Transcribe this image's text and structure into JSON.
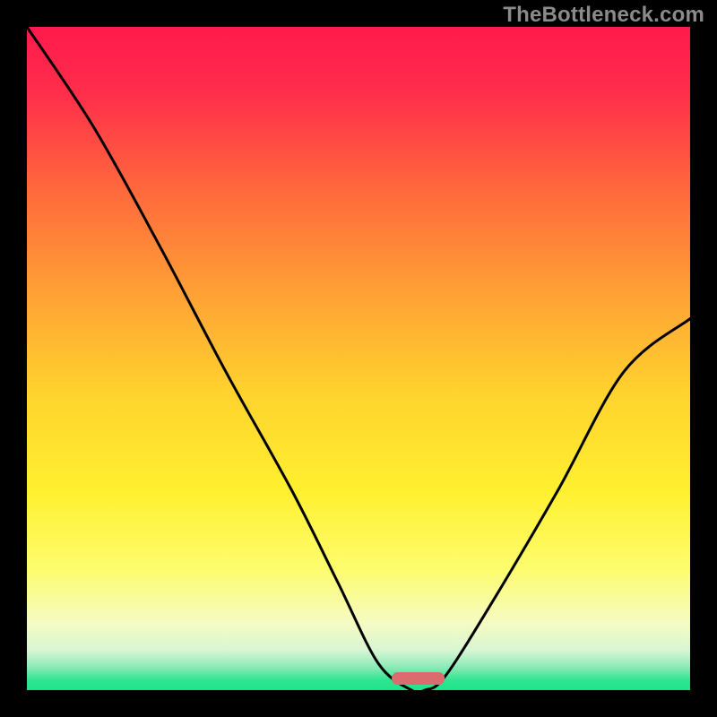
{
  "attribution": "TheBottleneck.com",
  "chart_data": {
    "type": "line",
    "title": "",
    "xlabel": "",
    "ylabel": "",
    "xlim": [
      0,
      100
    ],
    "ylim": [
      0,
      100
    ],
    "grid": false,
    "series": [
      {
        "name": "bottleneck-curve",
        "x": [
          0,
          10,
          20,
          30,
          40,
          47,
          53,
          58,
          60,
          63,
          70,
          80,
          90,
          100
        ],
        "values": [
          100,
          85,
          67,
          48,
          30,
          16,
          4,
          0,
          0,
          2,
          13,
          30,
          48,
          56
        ]
      }
    ],
    "marker": {
      "name": "optimum-pill",
      "x_center": 59,
      "width": 8,
      "color": "#db6b6f"
    },
    "gradient_stops": [
      {
        "offset": 0.0,
        "color": "#ff1a4d"
      },
      {
        "offset": 0.1,
        "color": "#ff2e4a"
      },
      {
        "offset": 0.25,
        "color": "#ff6a3c"
      },
      {
        "offset": 0.4,
        "color": "#ffa035"
      },
      {
        "offset": 0.55,
        "color": "#ffd22e"
      },
      {
        "offset": 0.7,
        "color": "#fff02f"
      },
      {
        "offset": 0.82,
        "color": "#fdfd70"
      },
      {
        "offset": 0.9,
        "color": "#f5fbc4"
      },
      {
        "offset": 0.94,
        "color": "#d7f6d3"
      },
      {
        "offset": 0.965,
        "color": "#8deab8"
      },
      {
        "offset": 0.985,
        "color": "#2fe58f"
      },
      {
        "offset": 1.0,
        "color": "#1fe38c"
      }
    ]
  }
}
